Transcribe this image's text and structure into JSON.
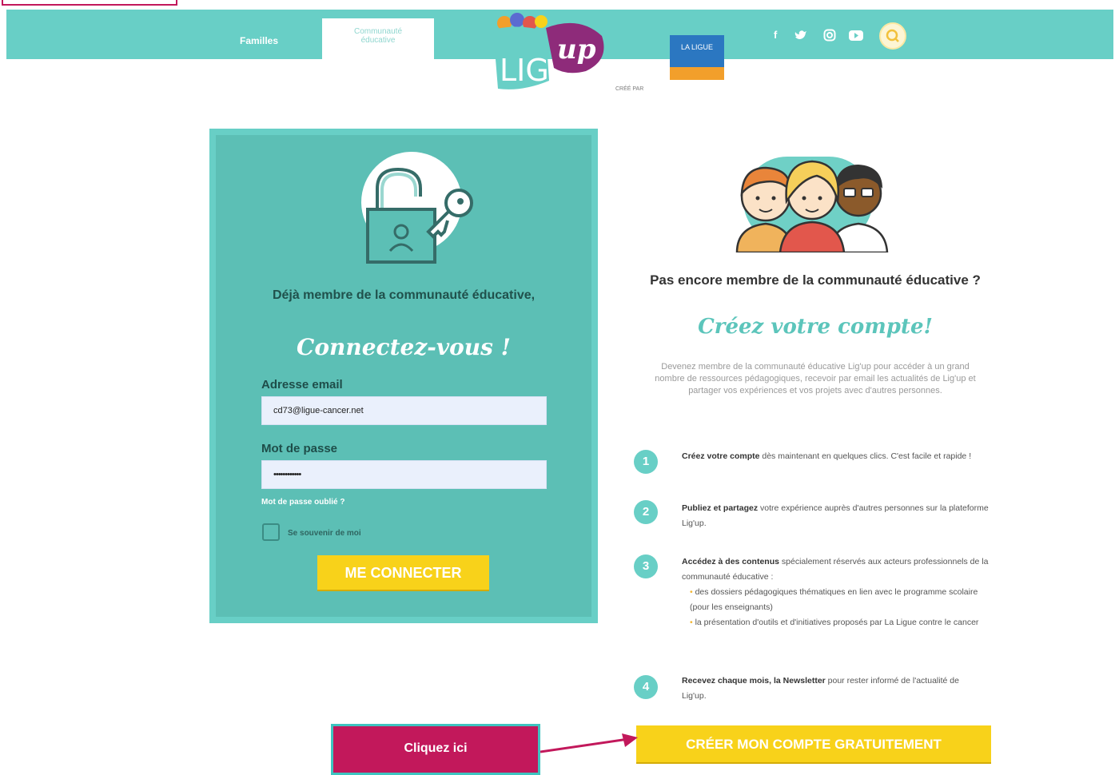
{
  "header": {
    "tabs": [
      {
        "label": "Familles",
        "active": false
      },
      {
        "label": "Communauté éducative",
        "active": true
      }
    ],
    "logo_text": "LIG'up",
    "created_by_label": "CRÉÉ PAR",
    "partner_logo_text": "LA LIGUE",
    "socials": [
      "facebook-icon",
      "twitter-icon",
      "instagram-icon",
      "youtube-icon"
    ],
    "search_icon": "search-icon"
  },
  "login": {
    "heading": "Déjà membre de la communauté éducative,",
    "script_title": "Connectez-vous !",
    "email_label": "Adresse email",
    "email_value": "cd73@ligue-cancer.net",
    "password_label": "Mot de passe",
    "password_value": "••••••••••••",
    "forgot_link": "Mot de passe oublié ?",
    "remember_label": "Se souvenir de moi",
    "submit_label": "ME CONNECTER"
  },
  "signup": {
    "heading": "Pas encore membre de la communauté éducative ?",
    "script_title": "Créez votre compte!",
    "intro": "Devenez membre de la communauté éducative Lig'up pour accéder à un grand nombre de ressources pédagogiques, recevoir par email les actualités de Lig'up et partager vos expériences et vos projets avec d'autres personnes.",
    "steps": [
      {
        "num": "1",
        "bold": "Créez votre compte",
        "text": " dès maintenant en quelques clics. C'est facile et rapide !"
      },
      {
        "num": "2",
        "bold": "Publiez et partagez",
        "text": " votre expérience auprès d'autres personnes sur la plateforme Lig'up."
      },
      {
        "num": "3",
        "bold": "Accédez à des contenus",
        "text": " spécialement réservés aux acteurs professionnels de la communauté éducative :",
        "bullets": [
          "des dossiers pédagogiques thématiques en lien avec le programme scolaire (pour les enseignants)",
          "la présentation d'outils et d'initiatives proposés par La Ligue contre le cancer"
        ]
      },
      {
        "num": "4",
        "bold": "Recevez chaque mois, la Newsletter",
        "text": " pour rester informé de l'actualité de Lig'up."
      }
    ],
    "create_button": "CRÉER MON COMPTE GRATUITEMENT"
  },
  "callout": {
    "label": "Cliquez ici",
    "color": "#c2185b"
  },
  "colors": {
    "teal": "#68cfc6",
    "yellow": "#f8d21a",
    "callout_pink": "#c2185b"
  }
}
